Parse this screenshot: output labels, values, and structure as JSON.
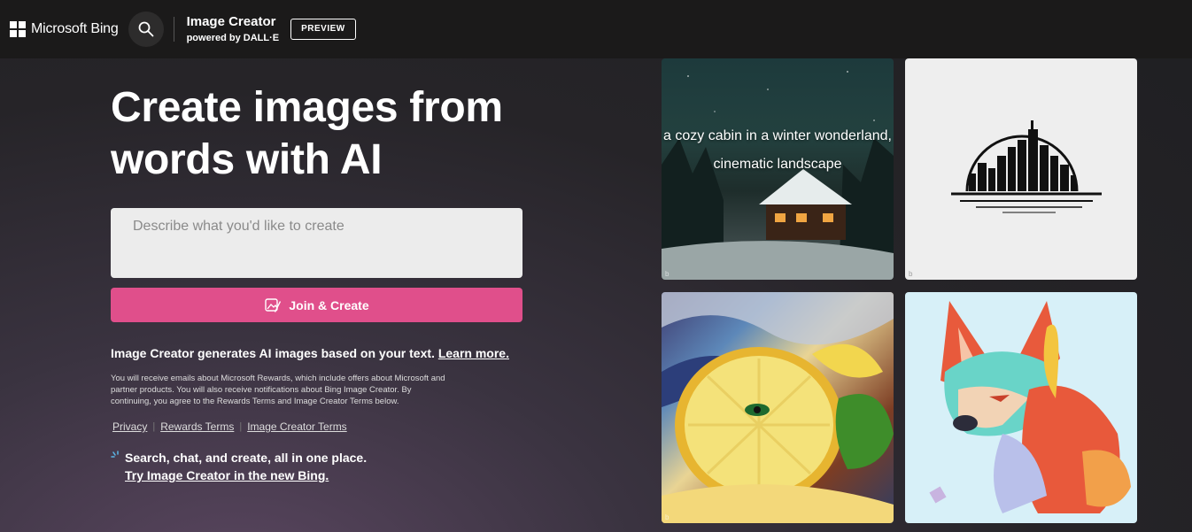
{
  "header": {
    "brand": "Microsoft Bing",
    "title": "Image Creator",
    "subtitle_prefix": "powered by ",
    "subtitle_brand": "DALL·E",
    "badge": "PREVIEW"
  },
  "hero": {
    "title": "Create images from words with AI"
  },
  "prompt": {
    "placeholder": "Describe what you'd like to create",
    "value": ""
  },
  "create_button": {
    "label": "Join & Create"
  },
  "description": {
    "text": "Image Creator generates AI images based on your text. ",
    "link": "Learn more."
  },
  "fine_print": "You will receive emails about Microsoft Rewards, which include offers about Microsoft and partner products. You will also receive notifications about Bing Image Creator. By continuing, you agree to the Rewards Terms and Image Creator Terms below.",
  "legal_links": [
    "Privacy",
    "Rewards Terms",
    "Image Creator Terms"
  ],
  "promo": {
    "text": "Search, chat, and create, all in one place.",
    "link": "Try Image Creator in the new Bing."
  },
  "gallery": {
    "cabin_caption": "a cozy cabin in a winter wonderland, cinematic landscape",
    "tiles": [
      "cabin-image",
      "city-skyline-image",
      "lemon-painting-image",
      "paper-wolf-image"
    ]
  },
  "colors": {
    "accent": "#e04f8b",
    "header_bg": "#1b1a1a",
    "input_bg": "#ececec"
  }
}
